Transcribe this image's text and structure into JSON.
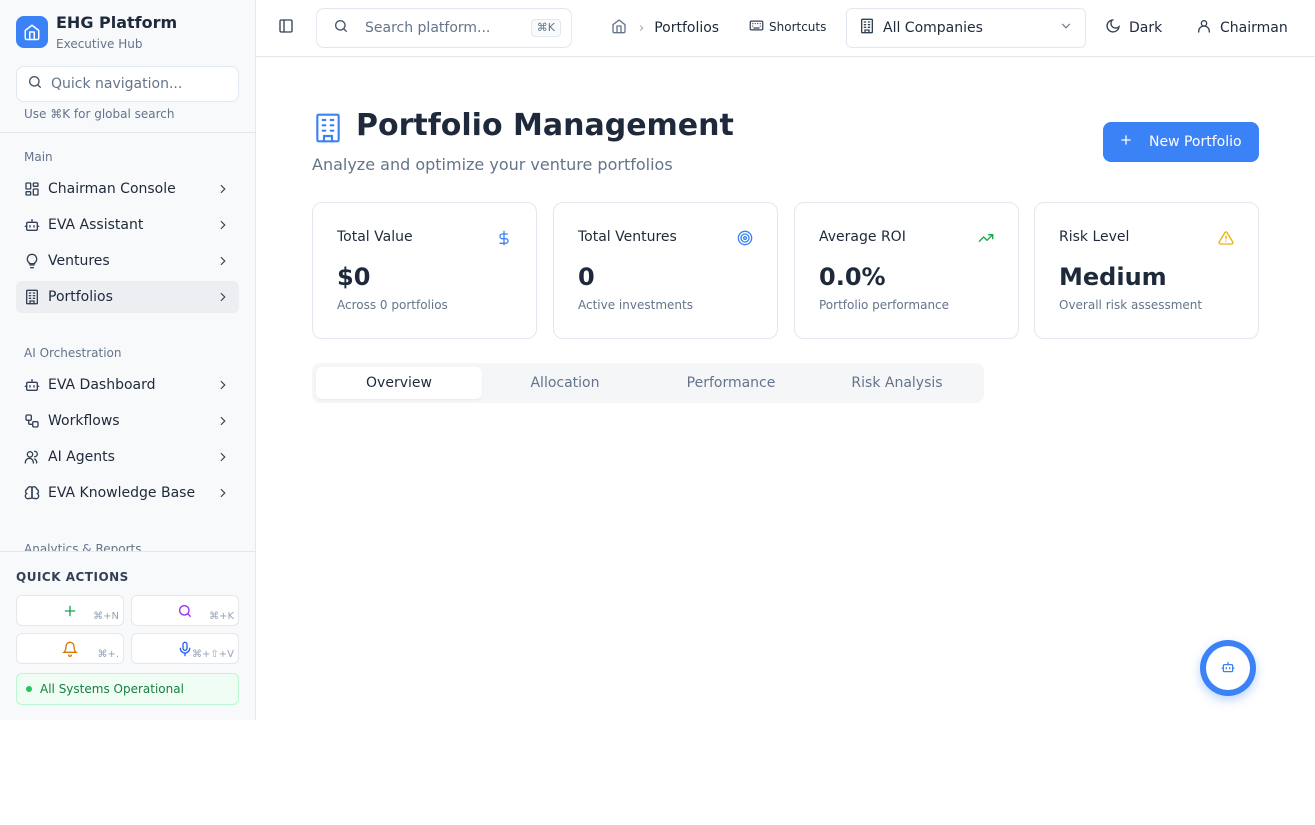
{
  "brand": {
    "title": "EHG Platform",
    "subtitle": "Executive Hub"
  },
  "sidebar": {
    "search_placeholder": "Quick navigation...",
    "search_hint": "Use ⌘K for global search",
    "sections": [
      {
        "label": "Main",
        "items": [
          {
            "label": "Chairman Console",
            "icon": "layout-grid-icon"
          },
          {
            "label": "EVA Assistant",
            "icon": "bot-icon"
          },
          {
            "label": "Ventures",
            "icon": "lightbulb-icon"
          },
          {
            "label": "Portfolios",
            "icon": "building-icon",
            "active": true
          }
        ]
      },
      {
        "label": "AI Orchestration",
        "items": [
          {
            "label": "EVA Dashboard",
            "icon": "bot-icon"
          },
          {
            "label": "Workflows",
            "icon": "workflow-icon"
          },
          {
            "label": "AI Agents",
            "icon": "users-icon"
          },
          {
            "label": "EVA Knowledge Base",
            "icon": "brain-icon"
          }
        ]
      },
      {
        "label": "Analytics & Reports",
        "items": []
      }
    ],
    "quick_actions": {
      "title": "QUICK ACTIONS",
      "buttons": [
        {
          "icon": "plus-icon",
          "shortcut": "⌘+N",
          "color": "#16a34a"
        },
        {
          "icon": "search-icon",
          "shortcut": "⌘+K",
          "color": "#9333ea"
        },
        {
          "icon": "bell-icon",
          "shortcut": "⌘+.",
          "color": "#d97706"
        },
        {
          "icon": "mic-icon",
          "shortcut": "⌘+⇧+V",
          "color": "#2563eb"
        }
      ]
    },
    "status": "All Systems Operational"
  },
  "header": {
    "search_placeholder": "Search platform...",
    "search_kbd": "⌘K",
    "breadcrumb": [
      "Portfolios"
    ],
    "shortcuts_label": "Shortcuts",
    "company_select": "All Companies",
    "theme_label": "Dark",
    "user_label": "Chairman"
  },
  "page": {
    "title": "Portfolio Management",
    "subtitle": "Analyze and optimize your venture portfolios",
    "new_button": "New Portfolio"
  },
  "stats": [
    {
      "title": "Total Value",
      "value": "$0",
      "sub": "Across 0 portfolios",
      "icon": "dollar-icon",
      "color": "#3b82f6"
    },
    {
      "title": "Total Ventures",
      "value": "0",
      "sub": "Active investments",
      "icon": "target-icon",
      "color": "#3b82f6"
    },
    {
      "title": "Average ROI",
      "value": "0.0%",
      "sub": "Portfolio performance",
      "icon": "trending-up-icon",
      "color": "#16a34a"
    },
    {
      "title": "Risk Level",
      "value": "Medium",
      "sub": "Overall risk assessment",
      "icon": "alert-triangle-icon",
      "color": "#eab308"
    }
  ],
  "tabs": [
    {
      "label": "Overview",
      "active": true
    },
    {
      "label": "Allocation"
    },
    {
      "label": "Performance"
    },
    {
      "label": "Risk Analysis"
    }
  ]
}
